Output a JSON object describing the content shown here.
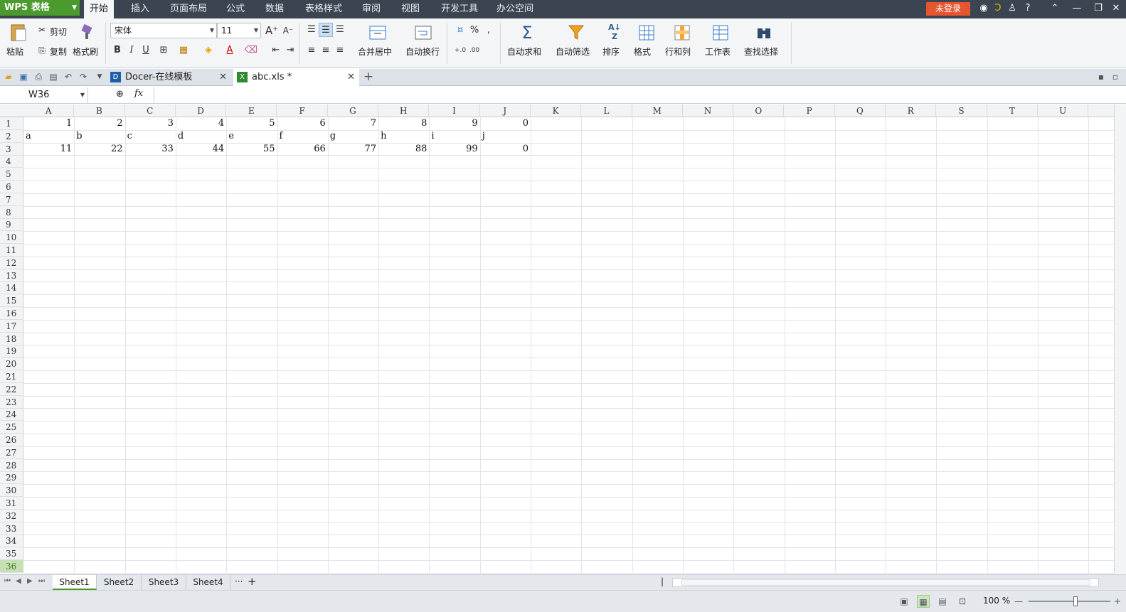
{
  "app": {
    "logo": "WPS 表格",
    "login": "未登录"
  },
  "menu": {
    "tabs": [
      "开始",
      "插入",
      "页面布局",
      "公式",
      "数据",
      "表格样式",
      "审阅",
      "视图",
      "开发工具",
      "办公空间"
    ]
  },
  "ribbon": {
    "paste": "粘贴",
    "cut": "剪切",
    "copy": "复制",
    "format_painter": "格式刷",
    "font_name": "宋体",
    "font_size": "11",
    "bold": "B",
    "italic": "I",
    "underline": "U",
    "merge_center": "合并居中",
    "wrap_text": "自动换行",
    "percent": "%",
    "comma": ",",
    "inc_decimal": "+.0 .00",
    "dec_decimal": ".00 →.0",
    "autosum": "自动求和",
    "autofilter": "自动筛选",
    "sort": "排序",
    "format": "格式",
    "rows_cols": "行和列",
    "worksheet": "工作表",
    "find_select": "查找选择"
  },
  "doc_tabs": [
    {
      "label": "Docer-在线模板"
    },
    {
      "label": "abc.xls *"
    }
  ],
  "formula_bar": {
    "name_box": "W36",
    "fx": "fx",
    "value": ""
  },
  "grid": {
    "columns": [
      "A",
      "B",
      "C",
      "D",
      "E",
      "F",
      "G",
      "H",
      "I",
      "J",
      "K",
      "L",
      "M",
      "N",
      "O",
      "P",
      "Q",
      "R",
      "S",
      "T",
      "U"
    ],
    "rows": [
      "1",
      "2",
      "3",
      "4",
      "5",
      "6",
      "7",
      "8",
      "9",
      "10",
      "11",
      "12",
      "13",
      "14",
      "15",
      "16",
      "17",
      "18",
      "19",
      "20",
      "21",
      "22",
      "23",
      "24",
      "25",
      "26",
      "27",
      "28",
      "29",
      "30",
      "31",
      "32",
      "33",
      "34",
      "35",
      "36"
    ],
    "selected_row": "36",
    "cells": [
      [
        "1",
        "2",
        "3",
        "4",
        "5",
        "6",
        "7",
        "8",
        "9",
        "0"
      ],
      [
        "a",
        "b",
        "c",
        "d",
        "e",
        "f",
        "g",
        "h",
        "i",
        "j"
      ],
      [
        "11",
        "22",
        "33",
        "44",
        "55",
        "66",
        "77",
        "88",
        "99",
        "0"
      ]
    ]
  },
  "sheets": [
    "Sheet1",
    "Sheet2",
    "Sheet3",
    "Sheet4"
  ],
  "sheet_more": "···",
  "sheet_add": "+",
  "status": {
    "zoom": "100 %"
  },
  "colors": {
    "accent": "#4a9a2e",
    "titlebar": "#3b4551",
    "login": "#e5552f"
  }
}
